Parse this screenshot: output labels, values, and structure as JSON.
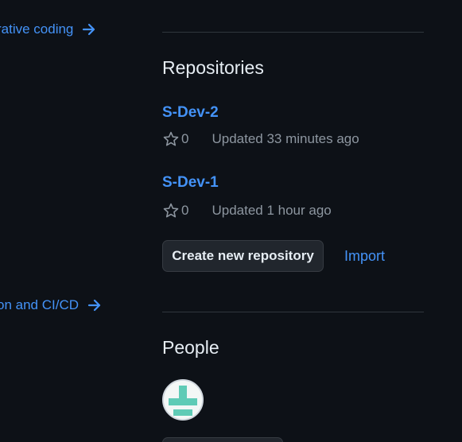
{
  "left_links": [
    {
      "label": "rative coding"
    },
    {
      "label": "on and CI/CD"
    }
  ],
  "repositories": {
    "title": "Repositories",
    "items": [
      {
        "name": "S-Dev-2",
        "stars": "0",
        "updated": "Updated 33 minutes ago"
      },
      {
        "name": "S-Dev-1",
        "stars": "0",
        "updated": "Updated 1 hour ago"
      }
    ],
    "create_button_label": "Create new repository",
    "import_label": "Import"
  },
  "people": {
    "title": "People"
  },
  "colors": {
    "background": "#0d1117",
    "link": "#4493f8",
    "text": "#e6edf3",
    "muted": "#8d96a0",
    "border": "#30363d",
    "avatar_accent": "#5fcbb6"
  }
}
